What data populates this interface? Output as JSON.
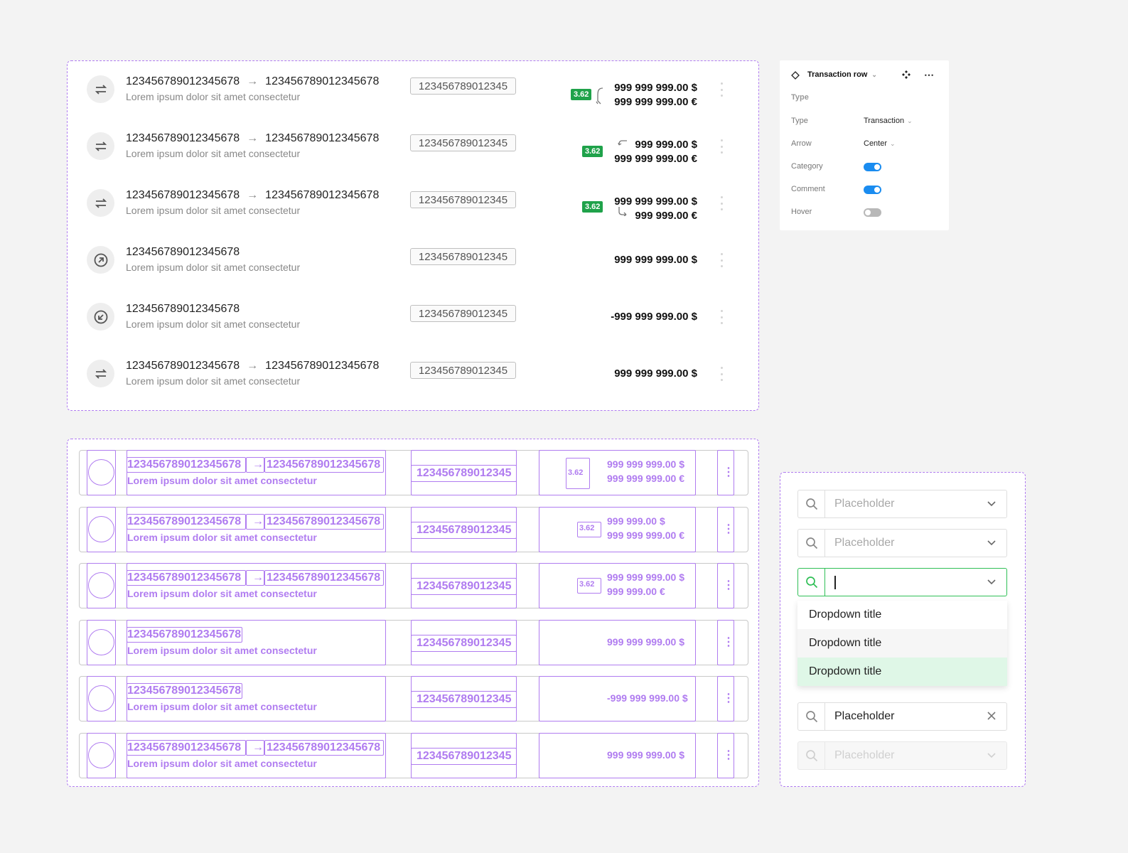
{
  "transactions": [
    {
      "from": "123456789012345678",
      "arrow": "→",
      "to": "123456789012345678",
      "desc": "Lorem ipsum dolor sit amet consectetur",
      "id": "123456789012345",
      "badge": "3.62",
      "amount1": "999 999 999.00 $",
      "amount2": "999 999 999.00 €",
      "icon": "transfer-icon"
    },
    {
      "from": "123456789012345678",
      "arrow": "→",
      "to": "123456789012345678",
      "desc": "Lorem ipsum dolor sit amet consectetur",
      "id": "123456789012345",
      "badge": "3.62",
      "amount1": "999 999.00 $",
      "amount2": "999 999 999.00 €",
      "icon": "transfer-icon"
    },
    {
      "from": "123456789012345678",
      "arrow": "→",
      "to": "123456789012345678",
      "desc": "Lorem ipsum dolor sit amet consectetur",
      "id": "123456789012345",
      "badge": "3.62",
      "amount1": "999 999 999.00 $",
      "amount2": "999 999.00 €",
      "icon": "transfer-icon"
    },
    {
      "from": "123456789012345678",
      "desc": "Lorem ipsum dolor sit amet consectetur",
      "id": "123456789012345",
      "amount1": "999 999 999.00 $",
      "icon": "outgoing-arrow-icon"
    },
    {
      "from": "123456789012345678",
      "desc": "Lorem ipsum dolor sit amet consectetur",
      "id": "123456789012345",
      "amount1": "-999 999 999.00 $",
      "icon": "incoming-arrow-icon"
    },
    {
      "from": "123456789012345678",
      "arrow": "→",
      "to": "123456789012345678",
      "desc": "Lorem ipsum dolor sit amet consectetur",
      "id": "123456789012345",
      "amount1": "999 999 999.00 $",
      "icon": "transfer-icon"
    }
  ],
  "props": {
    "title": "Transaction row",
    "section": "Type",
    "rows": [
      {
        "label": "Type",
        "value": "Transaction"
      },
      {
        "label": "Arrow",
        "value": "Center"
      },
      {
        "label": "Category",
        "toggle": true
      },
      {
        "label": "Comment",
        "toggle": true
      },
      {
        "label": "Hover",
        "toggle": false
      }
    ]
  },
  "dropdown": {
    "placeholder": "Placeholder",
    "filled_value": "Placeholder",
    "options": [
      "Dropdown title",
      "Dropdown title",
      "Dropdown title"
    ]
  },
  "colors": {
    "accent": "#b07cf0",
    "badge": "#1fa24a",
    "toggle_on": "#1a8cf0",
    "focus": "#2fbf56",
    "selected_option": "#dff7e7"
  }
}
